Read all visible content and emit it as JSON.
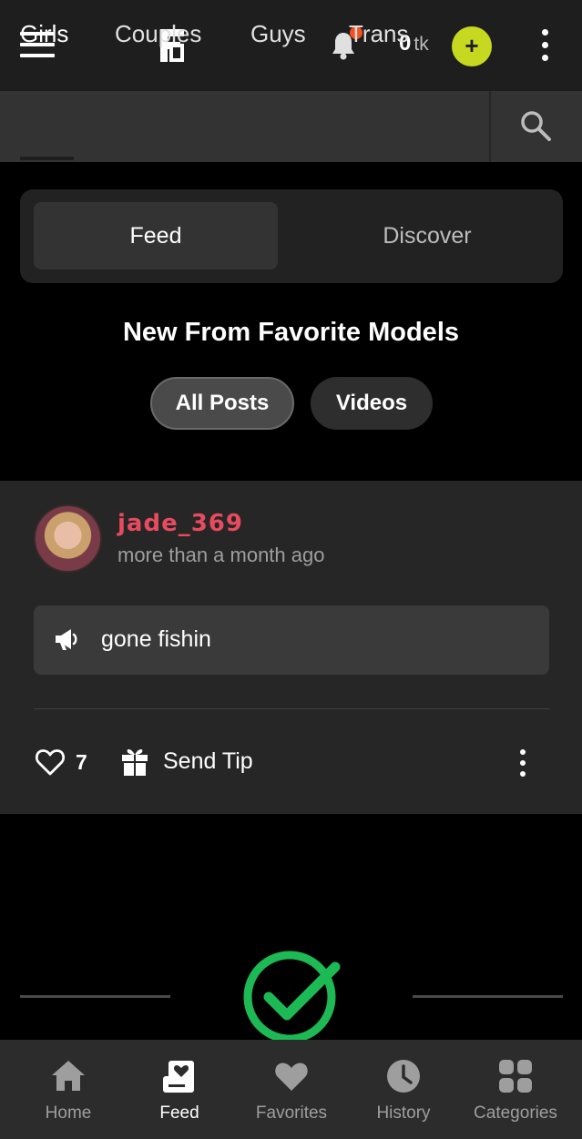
{
  "header": {
    "tokens_value": "0",
    "tokens_unit": "tk",
    "add_tokens_label": "+",
    "has_notification": true
  },
  "categories": {
    "tabs": [
      {
        "label": "Girls",
        "active": true
      },
      {
        "label": "Couples",
        "active": false
      },
      {
        "label": "Guys",
        "active": false
      },
      {
        "label": "Trans",
        "active": false
      }
    ]
  },
  "segment": {
    "feed_label": "Feed",
    "discover_label": "Discover",
    "selected": "Feed"
  },
  "section_title": "New From Favorite Models",
  "filters": {
    "all_posts_label": "All Posts",
    "videos_label": "Videos",
    "selected": "All Posts"
  },
  "post": {
    "username": "jade_369",
    "timestamp": "more than a month ago",
    "announcement": "gone fishin",
    "likes": "7",
    "tip_label": "Send Tip"
  },
  "bottom_nav": {
    "items": [
      {
        "label": "Home",
        "icon": "home-icon",
        "active": false
      },
      {
        "label": "Feed",
        "icon": "feed-icon",
        "active": true
      },
      {
        "label": "Favorites",
        "icon": "heart-icon",
        "active": false
      },
      {
        "label": "History",
        "icon": "clock-icon",
        "active": false
      },
      {
        "label": "Categories",
        "icon": "grid-icon",
        "active": false
      }
    ]
  },
  "colors": {
    "accent_add": "#c6d81f",
    "username": "#e84a5f",
    "notification_dot": "#f4511e",
    "check_green": "#1db954"
  }
}
